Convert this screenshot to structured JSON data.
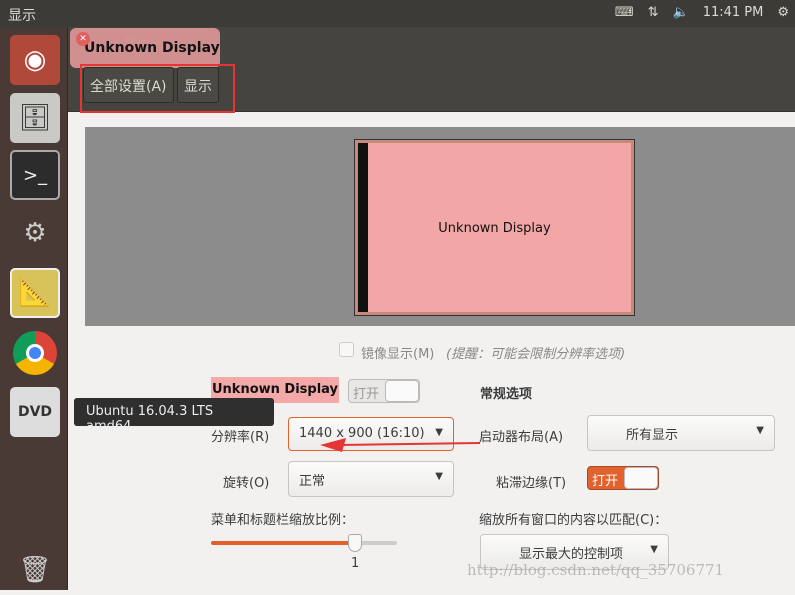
{
  "topbar": {
    "title": "显示",
    "time": "11:41 PM",
    "icons": [
      "keyboard-icon",
      "network-arrows-icon",
      "volume-icon",
      "gear-icon"
    ]
  },
  "launcher": {
    "items": [
      "ubuntu-dash-icon",
      "file-cabinet-icon",
      "terminal-icon",
      "system-settings-icon",
      "display-settings-icon",
      "chrome-icon",
      "dvd-icon",
      "trash-icon"
    ]
  },
  "window": {
    "title": "显示",
    "tooltip": "Unknown Display",
    "toolbar": {
      "all_settings": "全部设置(A)",
      "display": "显示"
    }
  },
  "preview": {
    "monitor_label": "Unknown Display"
  },
  "mirror": {
    "label": "镜像显示(M)",
    "hint": "(提醒：可能会限制分辨率选项)",
    "checked": false
  },
  "display": {
    "name": "Unknown Display",
    "switch_label": "打开",
    "switch_on": false,
    "resolution_label": "分辨率(R)",
    "resolution_value": "1440 x 900 (16:10)",
    "rotation_label": "旋转(O)",
    "rotation_value": "正常",
    "scale_label": "菜单和标题栏缩放比例：",
    "scale_value": "1"
  },
  "general": {
    "heading": "常规选项",
    "launcher_label": "启动器布局(A)",
    "launcher_value": "所有显示",
    "sticky_label": "粘滞边缘(T)",
    "sticky_switch": "打开",
    "sticky_on": true,
    "scale_all_label": "缩放所有窗口的内容以匹配(C)：",
    "scale_all_value": "显示最大的控制项"
  },
  "dvd_tooltip": "Ubuntu 16.04.3 LTS amd64",
  "watermark": "http://blog.csdn.net/qq_35706771",
  "colors": {
    "accent": "#e2612d",
    "annotation": "#e53535",
    "highlight": "#f2a6a6"
  }
}
